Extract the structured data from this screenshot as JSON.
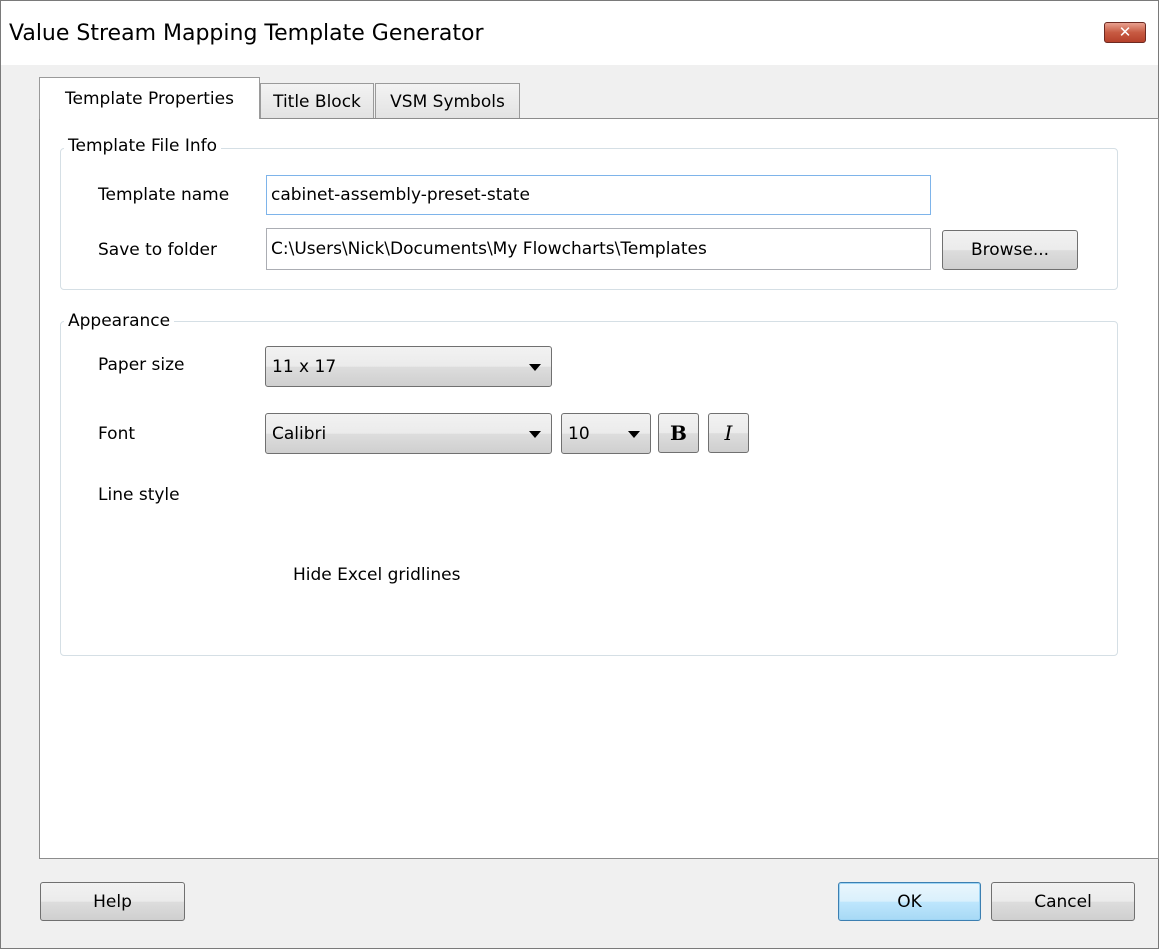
{
  "window": {
    "title": "Value Stream Mapping Template Generator",
    "close_glyph": "✕"
  },
  "tabs": [
    {
      "label": "Template Properties",
      "active": true
    },
    {
      "label": "Title Block",
      "active": false
    },
    {
      "label": "VSM Symbols",
      "active": false
    }
  ],
  "file_info": {
    "legend": "Template File Info",
    "name_label": "Template name",
    "name_value": "cabinet-assembly-preset-state",
    "folder_label": "Save to folder",
    "folder_value": "C:\\Users\\Nick\\Documents\\My Flowcharts\\Templates",
    "browse_label": "Browse..."
  },
  "appearance": {
    "legend": "Appearance",
    "paper_label": "Paper size",
    "paper_value": "11 x 17",
    "font_label": "Font",
    "font_value": "Calibri",
    "font_size_value": "10",
    "bold_label": "B",
    "italic_label": "I",
    "line_style_label": "Line style",
    "gridlines_label": "Hide Excel gridlines",
    "gridlines_checked": true
  },
  "footer": {
    "help_label": "Help",
    "ok_label": "OK",
    "cancel_label": "Cancel"
  },
  "colors": {
    "dialog_bg": "#f0f0f0",
    "panel_bg": "#ffffff",
    "focus_border": "#7eb4ea",
    "close_button": "#c75a42"
  },
  "icons": {
    "close": "close-icon",
    "dropdown": "chevron-down-icon",
    "check": "checkmark-icon"
  }
}
